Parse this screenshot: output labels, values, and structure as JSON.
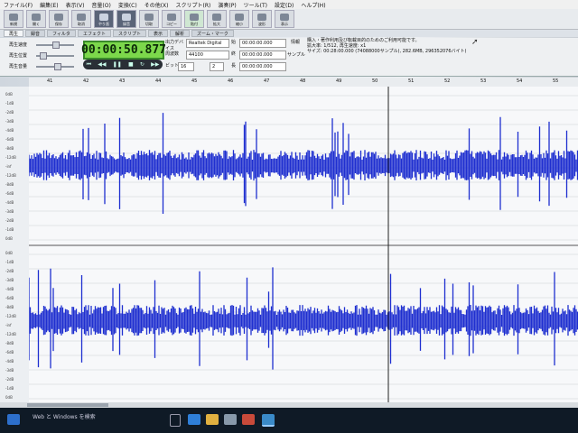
{
  "menu": [
    "ファイル(F)",
    "編集(E)",
    "表示(V)",
    "音量(O)",
    "変換(C)",
    "その他(X)",
    "スクリプト(R)",
    "演奏(P)",
    "ツール(T)",
    "設定(D)",
    "ヘルプ(H)"
  ],
  "toolbar": {
    "buttons": [
      "新規",
      "開く",
      "保存",
      "取消",
      "やり直",
      "録音",
      "切取",
      "コピー",
      "貼付",
      "拡大",
      "縮小",
      "波形",
      "表示"
    ]
  },
  "tabs": [
    "再生",
    "録音",
    "フィルタ",
    "エフェクト",
    "スクリプト",
    "表示",
    "解析",
    "ズーム・マーク"
  ],
  "controls": {
    "play_speed_label": "再生速度",
    "play_position_label": "再生位置",
    "play_volume_label": "再生音量",
    "time_display": "00:00:50.877",
    "output_device_label": "出力デバイス",
    "output_device": "Realtek Digital",
    "sample_rate_label": "周波数",
    "sample_rate": "44100",
    "bits_label": "ビット",
    "bits": "16",
    "channels": "2",
    "start_label": "始",
    "start_time": "00:00:00.000",
    "end_label": "終",
    "end_time": "00:00:00.000",
    "length_label": "長",
    "length_time": "00:00:00.000",
    "sample_unit": "サンプル",
    "info_label": "情報",
    "info_line1": "購入・著作利用及び転載目的のためのご利用可能です。",
    "info_line2": "拡大率: 1/512, 再生速度: x1",
    "info_line3": "サイズ: 00:28:00.000 (74088000サンプル), 282.6MB, 296352076バイト)"
  },
  "ruler": [
    "41",
    "42",
    "43",
    "44",
    "45",
    "46",
    "47",
    "48",
    "49",
    "50",
    "51",
    "52",
    "53",
    "54",
    "55"
  ],
  "axis_ch1": [
    "0dB",
    "-1dB",
    "-2dB",
    "-3dB",
    "-4dB",
    "-6dB",
    "-8dB",
    "-12dB",
    "-inf",
    "-12dB",
    "-8dB",
    "-6dB",
    "-4dB",
    "-3dB",
    "-2dB",
    "-1dB",
    "0dB"
  ],
  "axis_ch2": [
    "0dB",
    "-1dB",
    "-2dB",
    "-3dB",
    "-4dB",
    "-6dB",
    "-8dB",
    "-12dB",
    "-inf",
    "-12dB",
    "-8dB",
    "-6dB",
    "-4dB",
    "-3dB",
    "-2dB",
    "-1dB",
    "0dB"
  ],
  "taskbar": {
    "label": "Web と Windows を検索"
  },
  "colors": {
    "waveform": "#1f2fd0",
    "time_display": "#7cd84b",
    "taskbar": "#0f1a26"
  }
}
